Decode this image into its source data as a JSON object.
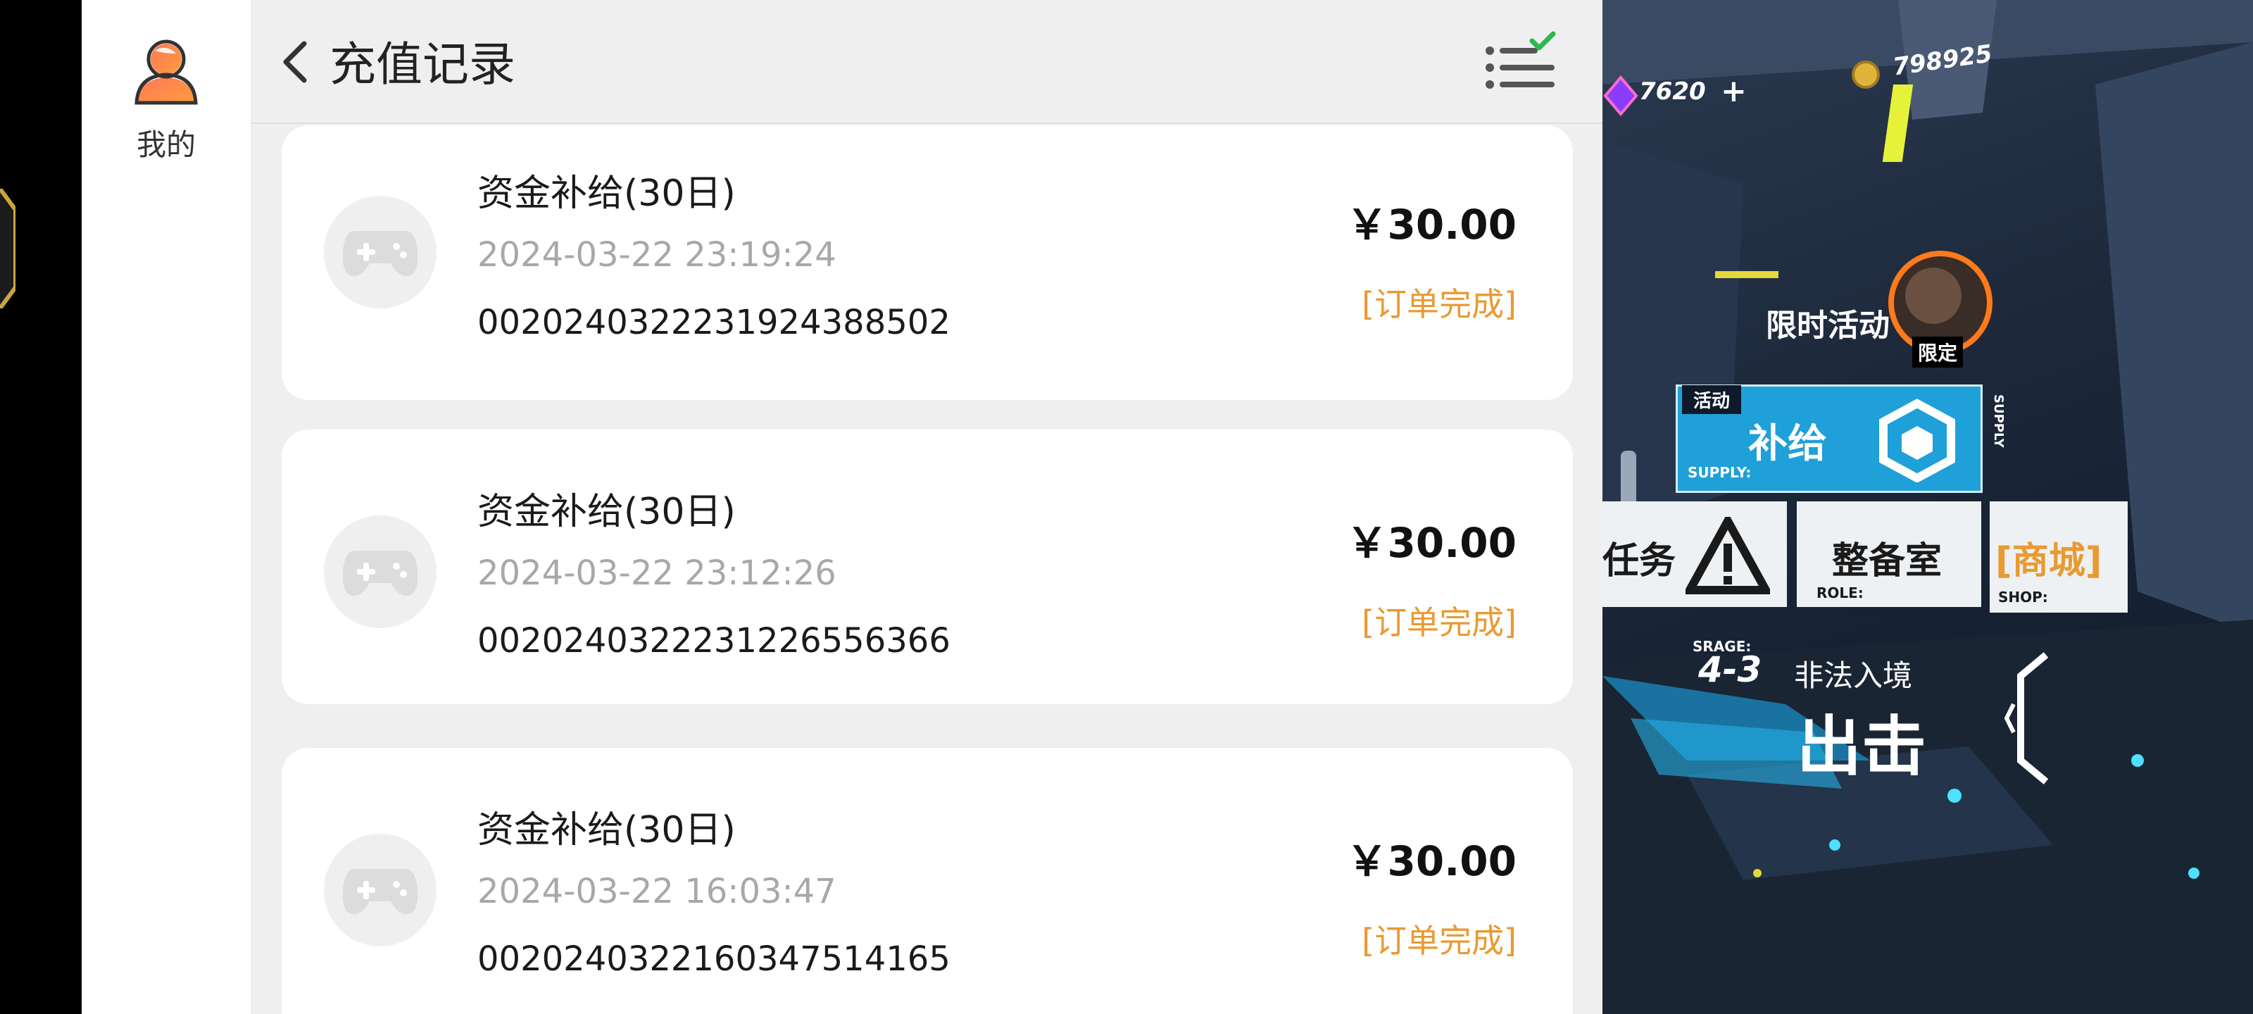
{
  "sidebar": {
    "label": "我的"
  },
  "header": {
    "title": "充值记录"
  },
  "records": [
    {
      "title": "资金补给(30日)",
      "time": "2024-03-22 23:19:24",
      "order": "0020240322231924388502",
      "amount": "￥30.00",
      "status": "[订单完成]"
    },
    {
      "title": "资金补给(30日)",
      "time": "2024-03-22 23:12:26",
      "order": "0020240322231226556366",
      "amount": "￥30.00",
      "status": "[订单完成]"
    },
    {
      "title": "资金补给(30日)",
      "time": "2024-03-22 16:03:47",
      "order": "0020240322160347514165",
      "amount": "￥30.00",
      "status": "[订单完成]"
    }
  ],
  "game": {
    "gems": "7620",
    "gems_plus": "+",
    "coins": "798925",
    "event_title": "限时活动",
    "event_sub": "限定",
    "activity_tag": "活动",
    "supply_title": "补给",
    "supply_label": "SUPPLY:",
    "supply_side": "SUPPLY",
    "mission": "任务",
    "armory": "整备室",
    "armory_label": "ROLE:",
    "shop": "[商城]",
    "shop_label": "SHOP:",
    "stage_label": "SRAGE:",
    "stage_num": "4-3",
    "stage_name": "非法入境",
    "sortie": "出击"
  },
  "colors": {
    "accent_orange": "#e99a32",
    "check_green": "#2db84d",
    "supply_blue": "#1fa0d8"
  }
}
